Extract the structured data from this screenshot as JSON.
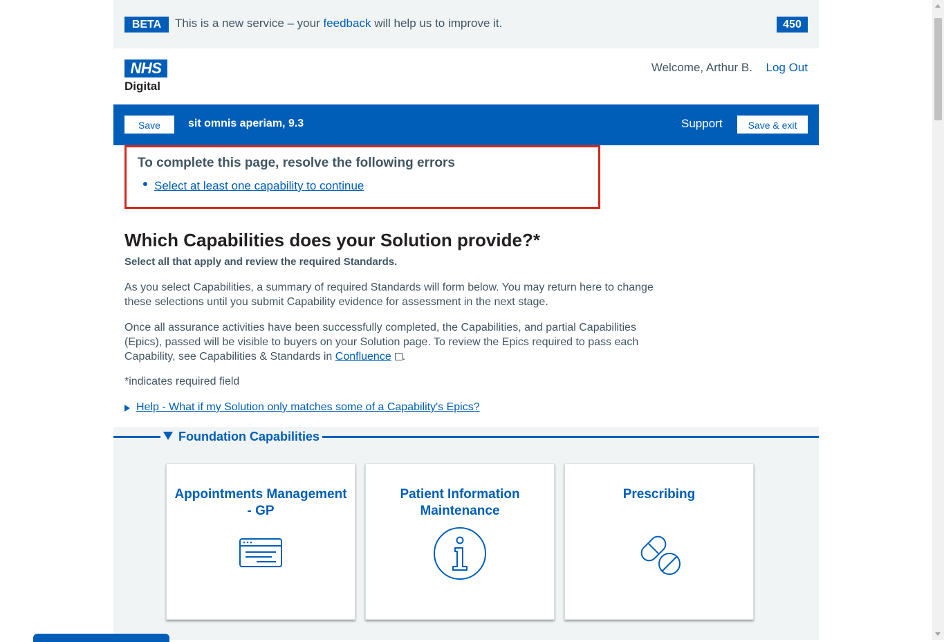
{
  "beta_banner": {
    "tag": "BETA",
    "text_before": "This is a new service – your ",
    "feedback_link": "feedback",
    "text_after": " will help us to improve it.",
    "badge": "450"
  },
  "header": {
    "logo_text": "NHS",
    "logo_subtext": "Digital",
    "welcome": "Welcome, Arthur B.",
    "logout": "Log Out"
  },
  "navbar": {
    "save_label": "Save",
    "title": "sit omnis aperiam, 9.3",
    "support": "Support",
    "save_exit_label": "Save & exit"
  },
  "error_summary": {
    "title": "To complete this page, resolve the following errors",
    "errors": [
      "Select at least one capability to continue"
    ]
  },
  "main": {
    "heading": "Which Capabilities does your Solution provide?*",
    "subheading": "Select all that apply and review the required Standards.",
    "paragraph1": "As you select Capabilities, a summary of required Standards will form below. You may return here to change these selections until you submit Capability evidence for assessment in the next stage.",
    "paragraph2_before": "Once all assurance activities have been successfully completed, the Capabilities, and partial Capabilities (Epics), passed will be visible to buyers on your Solution page. To review the Epics required to pass each Capability, see Capabilities & Standards in ",
    "paragraph2_link": "Confluence",
    "paragraph2_after": ".",
    "required_note": "*indicates required field",
    "help_link": "Help - What if my Solution only matches some of a Capability's Epics?"
  },
  "capabilities": {
    "section_title": "Foundation Capabilities",
    "cards": [
      {
        "title": "Appointments Management - GP",
        "icon": "calendar-window-icon"
      },
      {
        "title": "Patient Information Maintenance",
        "icon": "info-icon"
      },
      {
        "title": "Prescribing",
        "icon": "pill-icon"
      }
    ]
  },
  "colors": {
    "nhs_blue": "#005eb8",
    "error_red": "#d5281b",
    "text_grey": "#425563",
    "pale_grey": "#f0f4f5"
  }
}
